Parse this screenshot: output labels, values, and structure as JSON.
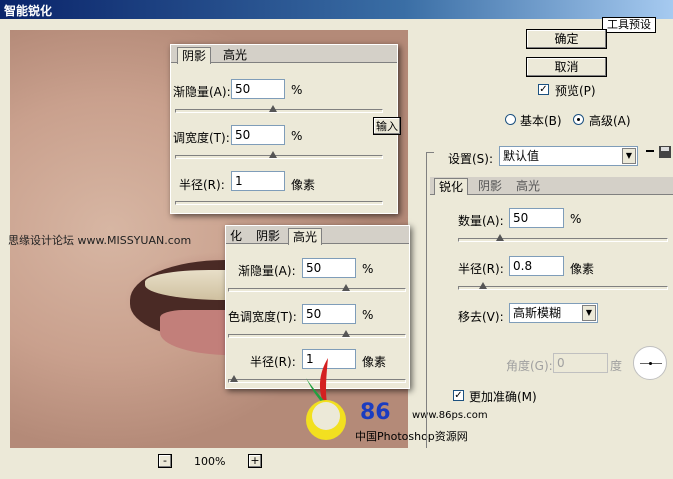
{
  "title": "智能锐化",
  "buttons": {
    "ok": "确定",
    "cancel": "取消",
    "tool_preset": "工具预设",
    "output_stub": "输入"
  },
  "preview_checkbox": {
    "label": "预览(P)",
    "checked": true
  },
  "mode": {
    "basic": "基本(B)",
    "advanced": "高级(A)",
    "selected": "advanced"
  },
  "settings": {
    "label": "设置(S):",
    "value": "默认值"
  },
  "main_tabs": [
    "锐化",
    "阴影",
    "高光"
  ],
  "sharpen": {
    "amount_label": "数量(A):",
    "amount_value": "50",
    "amount_unit": "%",
    "amount_level": 0.2,
    "radius_label": "半径(R):",
    "radius_value": "0.8",
    "radius_unit": "像素",
    "radius_level": 0.12,
    "remove_label": "移去(V):",
    "remove_value": "高斯模糊",
    "angle_label": "角度(G):",
    "angle_value": "0",
    "angle_unit": "度",
    "accurate_label": "更加准确(M)",
    "accurate_checked": true
  },
  "zoom": {
    "minus": "-",
    "value": "100%",
    "plus": "+"
  },
  "float_shadow": {
    "tabs": [
      "阴影",
      "高光"
    ],
    "fade_label": "渐隐量(A):",
    "fade_value": "50",
    "fade_unit": "%",
    "tonal_label": "调宽度(T):",
    "tonal_value": "50",
    "tonal_unit": "%",
    "radius_label": "半径(R):",
    "radius_value": "1",
    "radius_unit": "像素"
  },
  "float_highlight": {
    "tabs": [
      "化",
      "阴影",
      "高光"
    ],
    "fade_label": "渐隐量(A):",
    "fade_value": "50",
    "fade_unit": "%",
    "tonal_label": "色调宽度(T):",
    "tonal_value": "50",
    "tonal_unit": "%",
    "radius_label": "半径(R):",
    "radius_value": "1",
    "radius_unit": "像素"
  },
  "watermarks": {
    "missyuan": "思缘设计论坛 www.MISSYUAN.com",
    "site": "www.86ps.com",
    "logo_num": "86",
    "cn": "中国Photoshop资源网"
  }
}
